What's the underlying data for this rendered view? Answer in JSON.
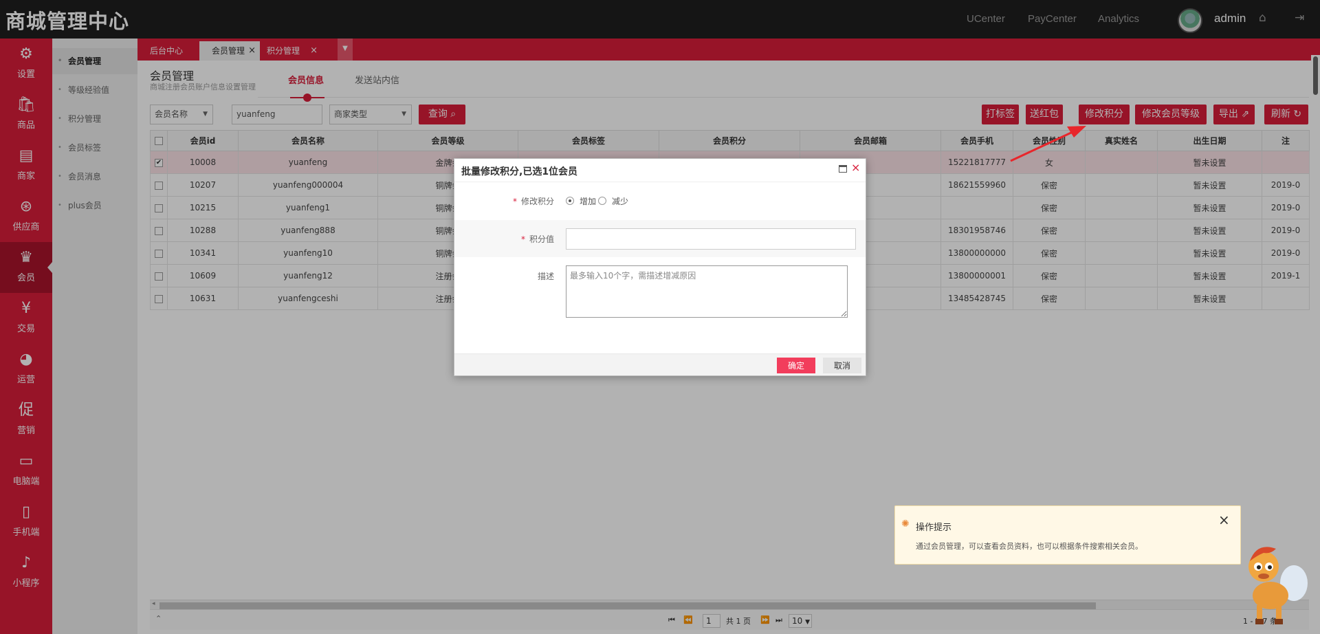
{
  "app": {
    "title": "商城管理中心"
  },
  "topnav": {
    "links": [
      "UCenter",
      "PayCenter",
      "Analytics"
    ],
    "user": "admin"
  },
  "leftnav": {
    "items": [
      {
        "label": "设置",
        "icon": "⚙"
      },
      {
        "label": "商品",
        "icon": "🛍"
      },
      {
        "label": "商家",
        "icon": "▤"
      },
      {
        "label": "供应商",
        "icon": "⊛"
      },
      {
        "label": "会员",
        "icon": "♛"
      },
      {
        "label": "交易",
        "icon": "¥"
      },
      {
        "label": "运营",
        "icon": "◕"
      },
      {
        "label": "营销",
        "icon": "促"
      },
      {
        "label": "电脑端",
        "icon": "▭"
      },
      {
        "label": "手机端",
        "icon": "▯"
      },
      {
        "label": "小程序",
        "icon": "♪"
      }
    ],
    "active": 4
  },
  "subnav": {
    "items": [
      "会员管理",
      "等级经验值",
      "积分管理",
      "会员标签",
      "会员消息",
      "plus会员"
    ],
    "active": 0
  },
  "tabs": [
    {
      "label": "后台中心"
    },
    {
      "label": "会员管理"
    },
    {
      "label": "积分管理"
    }
  ],
  "page": {
    "title": "会员管理",
    "subtitle": "商城注册会员账户信息设置管理",
    "content_tabs": [
      "会员信息",
      "发送站内信"
    ]
  },
  "filters": {
    "field_select": "会员名称",
    "keyword": "yuanfeng",
    "type_select": "商家类型",
    "search_label": "查询"
  },
  "actions": [
    "打标签",
    "送红包",
    "修改积分",
    "修改会员等级",
    "导出",
    "刷新"
  ],
  "table": {
    "columns": [
      "",
      "会员id",
      "会员名称",
      "会员等级",
      "会员标签",
      "会员积分",
      "会员邮箱",
      "会员手机",
      "会员性别",
      "真实姓名",
      "出生日期",
      "注"
    ],
    "rows": [
      {
        "checked": true,
        "id": "10008",
        "name": "yuanfeng",
        "level": "金牌会",
        "phone": "15221817777",
        "gender": "女",
        "birth": "暂未设置",
        "extra": ""
      },
      {
        "checked": false,
        "id": "10207",
        "name": "yuanfeng000004",
        "level": "铜牌会",
        "phone": "18621559960",
        "gender": "保密",
        "birth": "暂未设置",
        "extra": "2019-0"
      },
      {
        "checked": false,
        "id": "10215",
        "name": "yuanfeng1",
        "level": "铜牌会",
        "phone": "",
        "gender": "保密",
        "birth": "暂未设置",
        "extra": "2019-0"
      },
      {
        "checked": false,
        "id": "10288",
        "name": "yuanfeng888",
        "level": "铜牌会",
        "phone": "18301958746",
        "gender": "保密",
        "birth": "暂未设置",
        "extra": "2019-0"
      },
      {
        "checked": false,
        "id": "10341",
        "name": "yuanfeng10",
        "level": "铜牌会",
        "phone": "13800000000",
        "gender": "保密",
        "birth": "暂未设置",
        "extra": "2019-0"
      },
      {
        "checked": false,
        "id": "10609",
        "name": "yuanfeng12",
        "level": "注册会",
        "phone": "13800000001",
        "gender": "保密",
        "birth": "暂未设置",
        "extra": "2019-1"
      },
      {
        "checked": false,
        "id": "10631",
        "name": "yuanfengceshi",
        "level": "注册会",
        "phone": "13485428745",
        "gender": "保密",
        "birth": "暂未设置",
        "extra": ""
      }
    ]
  },
  "pager": {
    "page": "1",
    "total_pages": "共 1 页",
    "page_size": "10",
    "summary": "1 - 7   7 条"
  },
  "dialog": {
    "title": "批量修改积分,已选1位会员",
    "label_mode": "修改积分",
    "opt_add": "增加",
    "opt_sub": "减少",
    "label_value": "积分值",
    "label_desc": "描述",
    "desc_placeholder": "最多输入10个字，需描述增减原因",
    "ok": "确定",
    "cancel": "取消"
  },
  "tip": {
    "title": "操作提示",
    "text": "通过会员管理，可以查看会员资料，也可以根据条件搜索相关会员。"
  },
  "colors": {
    "primary": "#d81d3a",
    "topbar": "#1f1f1f",
    "arrow": "#e8262b"
  }
}
